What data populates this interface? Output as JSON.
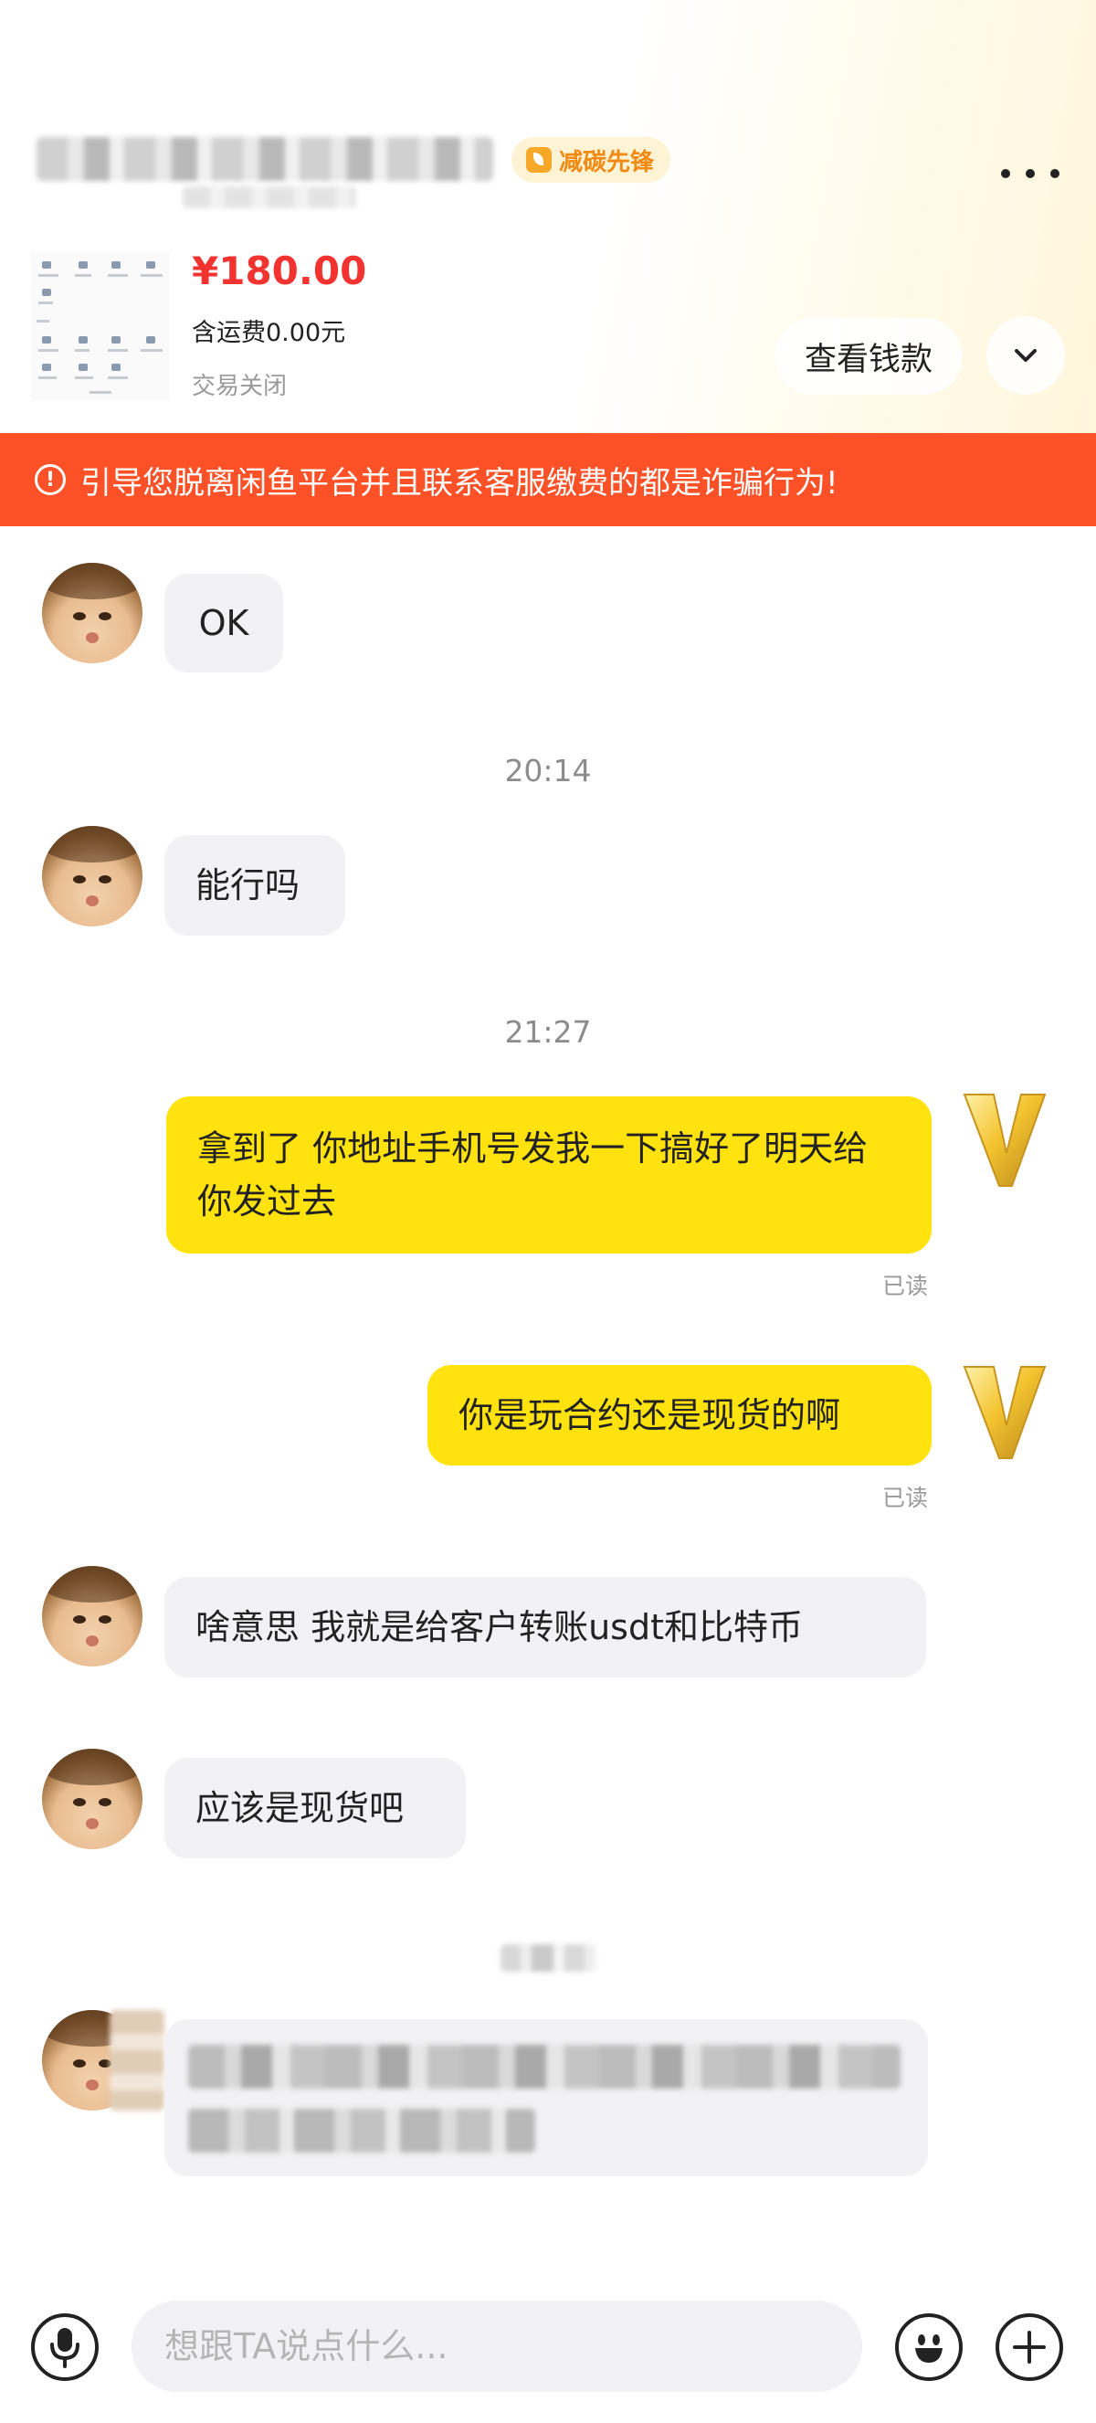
{
  "header": {
    "badge_label": "减碳先锋",
    "price": "¥180.00",
    "shipping": "含运费0.00元",
    "deal_status": "交易关闭",
    "view_payment_label": "查看钱款"
  },
  "warning": {
    "text": "引导您脱离闲鱼平台并且联系客服缴费的都是诈骗行为!",
    "color": "#ff5127"
  },
  "messages": [
    {
      "side": "in",
      "text": "OK"
    },
    {
      "type": "time",
      "text": "20:14"
    },
    {
      "side": "in",
      "text": "能行吗"
    },
    {
      "type": "time",
      "text": "21:27"
    },
    {
      "side": "out",
      "text": "拿到了  你地址手机号发我一下搞好了明天给你发过去",
      "status": "已读"
    },
    {
      "side": "out",
      "text": "你是玩合约还是现货的啊",
      "status": "已读"
    },
    {
      "side": "in",
      "text": "啥意思 我就是给客户转账usdt和比特币"
    },
    {
      "side": "in",
      "text": "应该是现货吧"
    }
  ],
  "composer": {
    "placeholder": "想跟TA说点什么..."
  },
  "colors": {
    "price": "#f2332f",
    "outgoing_bubble": "#ffe20e",
    "incoming_bubble": "#f2f2f4",
    "badge_text": "#f08a12"
  },
  "icons": [
    "more-dots-icon",
    "chevron-down-icon",
    "alert-circle-icon",
    "voice-mic-icon",
    "emoji-icon",
    "plus-icon",
    "gold-v-avatar-icon"
  ]
}
